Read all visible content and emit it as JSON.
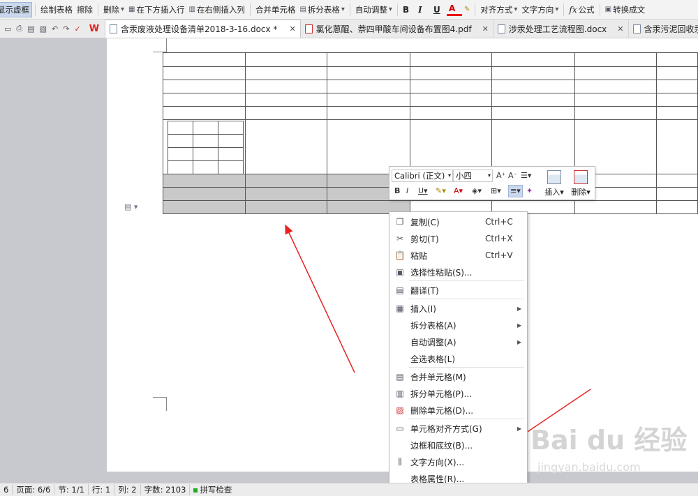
{
  "toolbar": {
    "items": [
      {
        "label": "显示虚框",
        "icon": "show-frame-icon",
        "active": true
      },
      {
        "label": "绘制表格",
        "icon": "draw-table-icon"
      },
      {
        "label": "擦除",
        "icon": "eraser-icon"
      },
      {
        "label": "删除",
        "icon": "delete-icon",
        "dropdown": true
      },
      {
        "label": "在下方插入行",
        "icon": "insert-row-below-icon"
      },
      {
        "label": "在右侧插入列",
        "icon": "insert-col-right-icon"
      },
      {
        "label": "合并单元格",
        "icon": "merge-cells-icon"
      },
      {
        "label": "拆分表格",
        "icon": "split-table-icon",
        "dropdown": true
      },
      {
        "label": "自动调整",
        "icon": "autofit-icon",
        "dropdown": true
      },
      {
        "label": "B"
      },
      {
        "label": "I"
      },
      {
        "label": "U"
      },
      {
        "label": "A"
      },
      {
        "label": "对齐方式",
        "dropdown": true
      },
      {
        "label": "文字方向",
        "dropdown": true
      },
      {
        "label": "公式",
        "icon": "fx-icon"
      },
      {
        "label": "转换成文",
        "icon": "convert-icon"
      }
    ]
  },
  "app": {
    "logo": "W"
  },
  "tabs": [
    {
      "label": "含汞废液处理设备清单2018-3-16.docx *",
      "active": true,
      "type": "docx"
    },
    {
      "label": "氯化蒽醌、萘四甲酸车间设备布置图4.pdf",
      "type": "pdf"
    },
    {
      "label": "涉汞处理工艺流程图.docx",
      "type": "docx"
    },
    {
      "label": "含汞污泥回收汞设备清单",
      "type": "docx"
    }
  ],
  "mini_toolbar": {
    "font": "Calibri (正文)",
    "size": "小四",
    "insert_label": "插入",
    "delete_label": "删除"
  },
  "context_menu": {
    "items": [
      {
        "label": "复制(C)",
        "shortcut": "Ctrl+C",
        "icon": "copy-icon"
      },
      {
        "label": "剪切(T)",
        "shortcut": "Ctrl+X",
        "icon": "cut-icon"
      },
      {
        "label": "粘贴",
        "shortcut": "Ctrl+V",
        "icon": "paste-icon"
      },
      {
        "label": "选择性粘贴(S)...",
        "shortcut": "",
        "icon": "paste-special-icon"
      },
      {
        "label": "翻译(T)",
        "shortcut": "",
        "icon": "translate-icon"
      },
      {
        "label": "插入(I)",
        "shortcut": "",
        "icon": "insert-icon",
        "submenu": true
      },
      {
        "label": "拆分表格(A)",
        "shortcut": "",
        "icon": "",
        "submenu": true
      },
      {
        "label": "自动调整(A)",
        "shortcut": "",
        "icon": "",
        "submenu": true
      },
      {
        "label": "全选表格(L)",
        "shortcut": "",
        "icon": ""
      },
      {
        "label": "合并单元格(M)",
        "shortcut": "",
        "icon": "merge-icon"
      },
      {
        "label": "拆分单元格(P)...",
        "shortcut": "",
        "icon": "split-icon"
      },
      {
        "label": "删除单元格(D)...",
        "shortcut": "",
        "icon": "delete-cell-icon"
      },
      {
        "label": "单元格对齐方式(G)",
        "shortcut": "",
        "icon": "cell-align-icon",
        "submenu": true
      },
      {
        "label": "边框和底纹(B)...",
        "shortcut": "",
        "icon": ""
      },
      {
        "label": "文字方向(X)...",
        "shortcut": "",
        "icon": "text-direction-icon"
      },
      {
        "label": "表格属性(R)...",
        "shortcut": "",
        "icon": ""
      }
    ]
  },
  "status": {
    "items": [
      "6",
      "页面: 6/6",
      "节: 1/1",
      "行: 1",
      "列: 2",
      "字数: 2103",
      "拼写检查"
    ]
  },
  "watermark": {
    "brand": "Bai du 经验",
    "url": "jingyan.baidu.com"
  },
  "colors": {
    "accent": "#2b579a",
    "arrow": "#e8231f",
    "selected_cell": "#c9c9c9"
  }
}
